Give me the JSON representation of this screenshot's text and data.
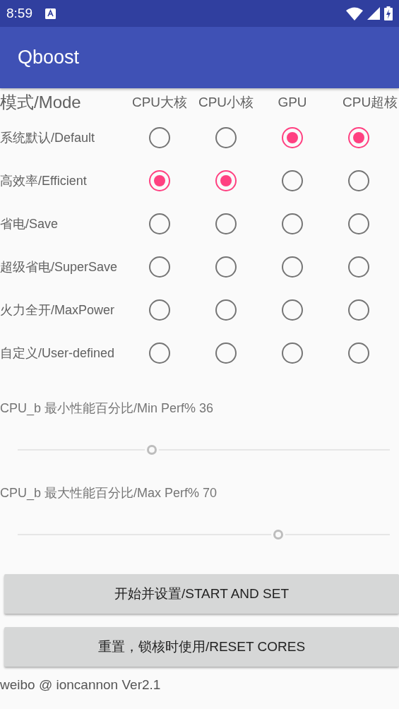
{
  "status_bar": {
    "time": "8:59"
  },
  "app_bar": {
    "title": "Qboost"
  },
  "mode_table": {
    "heading": "模式/Mode",
    "columns": [
      "CPU大核",
      "CPU小核",
      "GPU",
      "CPU超核"
    ],
    "rows": [
      {
        "label": "系统默认/Default",
        "options": [
          {
            "selected": false
          },
          {
            "selected": false
          },
          {
            "selected": true
          },
          {
            "selected": true
          }
        ]
      },
      {
        "label": "高效率/Efficient",
        "options": [
          {
            "selected": true
          },
          {
            "selected": true
          },
          {
            "selected": false
          },
          {
            "selected": false
          }
        ]
      },
      {
        "label": "省电/Save",
        "options": [
          {
            "selected": false
          },
          {
            "selected": false
          },
          {
            "selected": false
          },
          {
            "selected": false
          }
        ]
      },
      {
        "label": "超级省电/SuperSave",
        "options": [
          {
            "selected": false
          },
          {
            "selected": false
          },
          {
            "selected": false
          },
          {
            "selected": false
          }
        ]
      },
      {
        "label": "火力全开/MaxPower",
        "options": [
          {
            "selected": false
          },
          {
            "selected": false
          },
          {
            "selected": false
          },
          {
            "selected": false
          }
        ]
      },
      {
        "label": "自定义/User-defined",
        "options": [
          {
            "selected": false
          },
          {
            "selected": false
          },
          {
            "selected": false
          },
          {
            "selected": false
          }
        ]
      }
    ]
  },
  "sliders": [
    {
      "label": "CPU_b 最小性能百分比/Min Perf% 36",
      "level": 0.36
    },
    {
      "label": "CPU_b 最大性能百分比/Max Perf% 70",
      "level": 0.7
    }
  ],
  "buttons": [
    "开始并设置/START AND SET",
    "重置，锁核时使用/RESET CORES"
  ],
  "footer": "weibo @ ioncannon Ver2.1"
}
